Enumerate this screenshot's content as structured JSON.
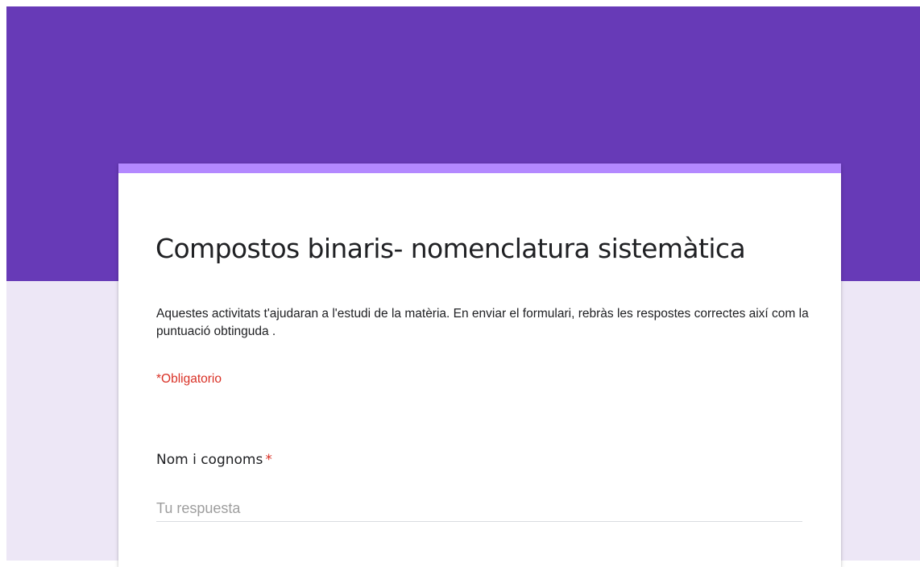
{
  "colors": {
    "header": "#673ab7",
    "card_accent": "#b388ff",
    "page_background": "#ede7f6",
    "required": "#d93025"
  },
  "form": {
    "title": "Compostos binaris- nomenclatura sistemàtica",
    "description": "Aquestes activitats t'ajudaran a l'estudi de la matèria. En enviar el formulari, rebràs les respostes correctes així com la puntuació obtinguda .",
    "required_note": "*Obligatorio"
  },
  "question": {
    "label": "Nom i cognoms",
    "required_mark": "*",
    "answer_placeholder": "Tu respuesta",
    "answer_value": ""
  }
}
